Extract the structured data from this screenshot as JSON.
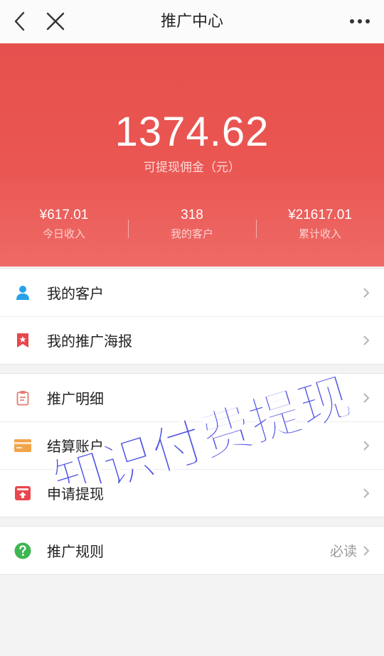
{
  "header": {
    "title": "推广中心"
  },
  "summary": {
    "amount": "1374.62",
    "amount_label": "可提现佣金（元）",
    "stats": [
      {
        "value": "¥617.01",
        "label": "今日收入"
      },
      {
        "value": "318",
        "label": "我的客户"
      },
      {
        "value": "¥21617.01",
        "label": "累计收入"
      }
    ]
  },
  "menu": {
    "group1": [
      {
        "label": "我的客户",
        "icon": "user-icon"
      },
      {
        "label": "我的推广海报",
        "icon": "bookmark-star-icon"
      }
    ],
    "group2": [
      {
        "label": "推广明细",
        "icon": "clipboard-icon"
      },
      {
        "label": "结算账户",
        "icon": "card-icon"
      },
      {
        "label": "申请提现",
        "icon": "withdraw-icon"
      }
    ],
    "group3": [
      {
        "label": "推广规则",
        "icon": "question-icon",
        "note": "必读"
      }
    ]
  },
  "watermark": {
    "line1": "知识付费提现"
  },
  "colors": {
    "hero_red": "#e6504d",
    "user_blue": "#2aa1e8",
    "poster_red": "#e8474c",
    "card_orange": "#f0a54a",
    "withdraw_red": "#e8474c",
    "rules_green": "#3fb651",
    "watermark_blue": "#3a3fe0"
  }
}
